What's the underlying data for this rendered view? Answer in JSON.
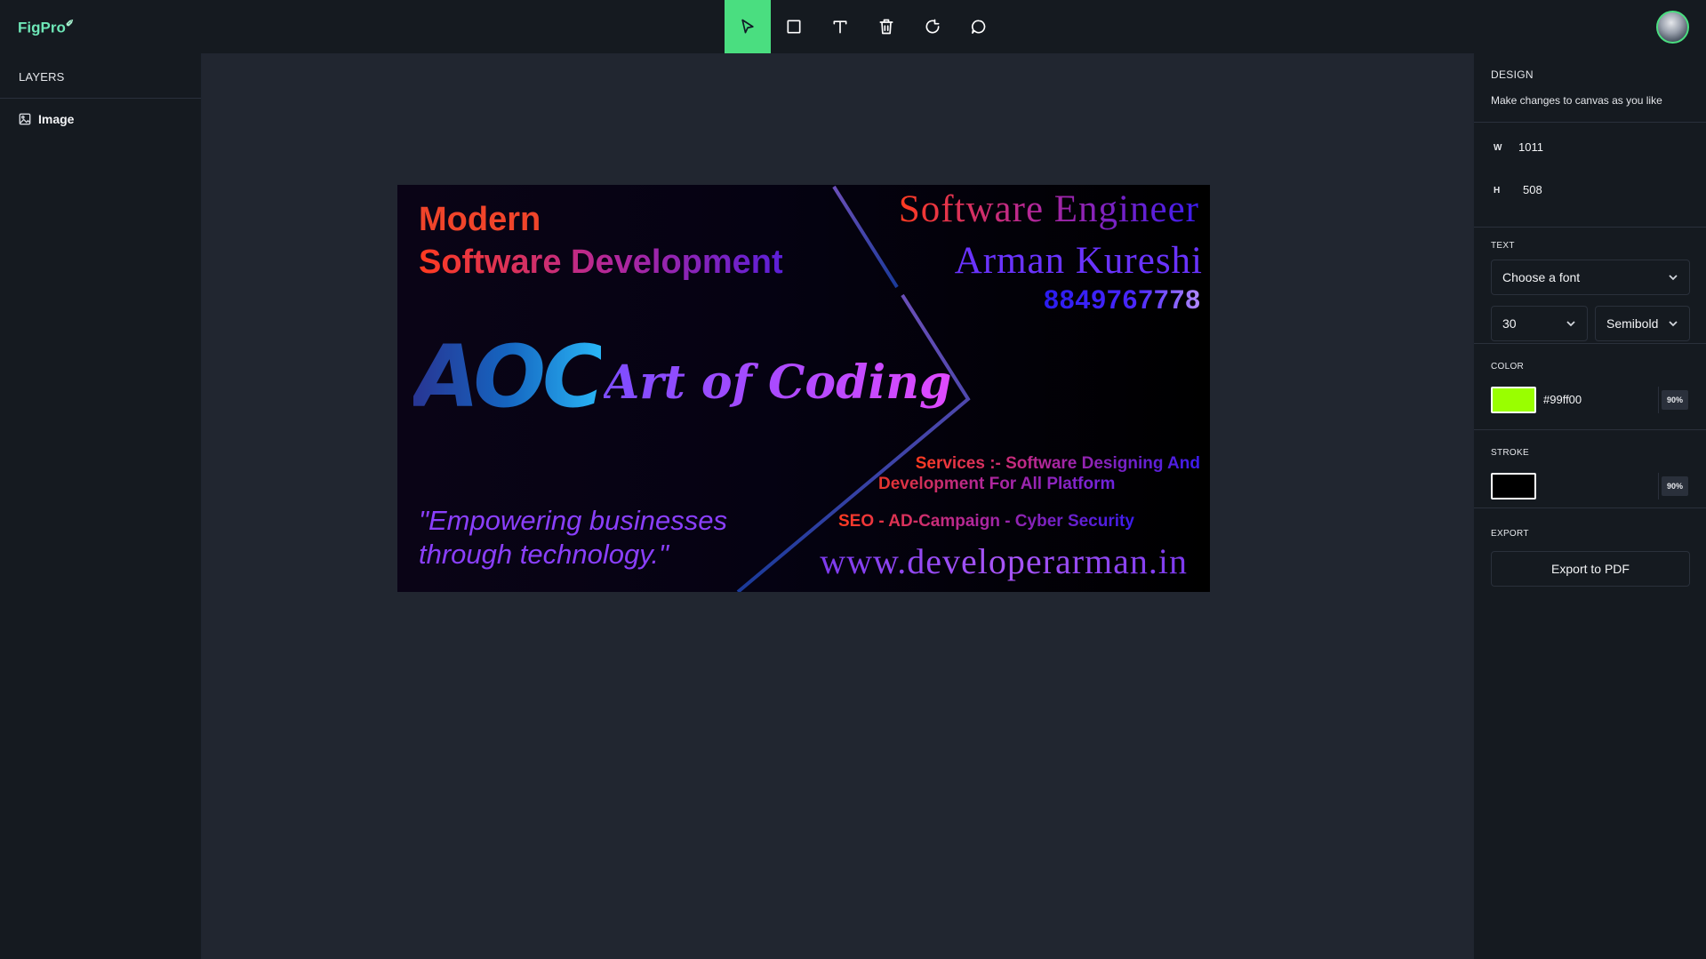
{
  "app": {
    "logo": "FigPro",
    "logo_mark": "✉"
  },
  "toolbar": {
    "tools": [
      {
        "name": "select",
        "icon": "cursor-icon",
        "active": true
      },
      {
        "name": "rectangle",
        "icon": "square-icon",
        "active": false
      },
      {
        "name": "text",
        "icon": "text-icon",
        "active": false
      },
      {
        "name": "delete",
        "icon": "trash-icon",
        "active": false
      },
      {
        "name": "reset",
        "icon": "rotate-icon",
        "active": false
      },
      {
        "name": "comments",
        "icon": "comment-icon",
        "active": false
      }
    ],
    "active_color": "#4ade80"
  },
  "layers": {
    "title": "LAYERS",
    "items": [
      {
        "label": "Image",
        "icon": "image-icon"
      }
    ]
  },
  "design": {
    "title": "DESIGN",
    "description": "Make changes to canvas as you like",
    "dimensions": {
      "w_label": "W",
      "w_value": "1011",
      "h_label": "H",
      "h_value": "508"
    },
    "text": {
      "title": "TEXT",
      "font_placeholder": "Choose a font",
      "size": "30",
      "weight": "Semibold"
    },
    "color": {
      "title": "COLOR",
      "swatch": "#99ff00",
      "hex": "#99ff00",
      "opacity": "90%"
    },
    "stroke": {
      "title": "STROKE",
      "swatch": "#000000",
      "opacity": "90%"
    },
    "export": {
      "title": "EXPORT",
      "button": "Export to PDF"
    }
  },
  "canvas_image": {
    "heading_line1": "Modern",
    "heading_line2": "Software Development",
    "logo_letters": "AOC",
    "logo_script": "Art of Coding",
    "quote_line1": "\"Empowering businesses",
    "quote_line2": "through technology.\"",
    "role": "Software Engineer",
    "name": "Arman Kureshi",
    "phone": "8849767778",
    "services_line1": "Services :- Software Designing And",
    "services_line2": "Development For All Platform",
    "seo": "SEO - AD-Campaign - Cyber Security",
    "website": "www.developerarman.in"
  }
}
